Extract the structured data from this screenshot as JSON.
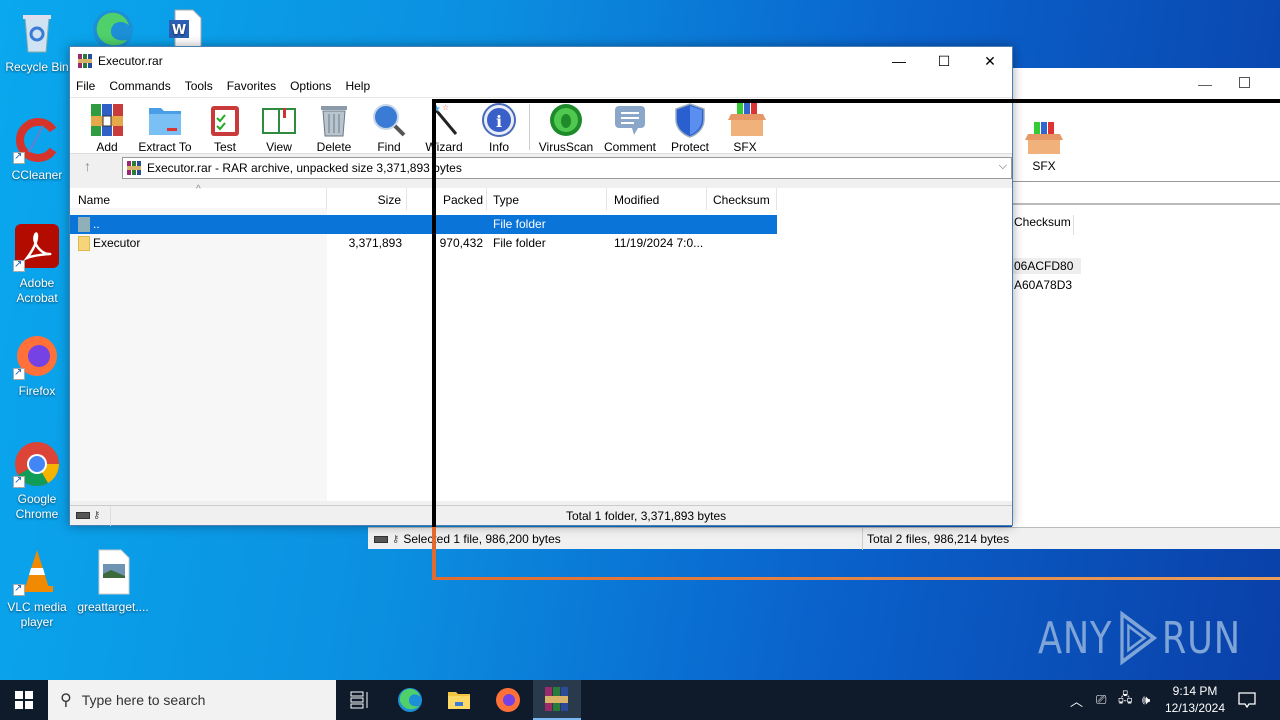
{
  "desktop": {
    "icons": [
      {
        "name": "recycle-bin",
        "label": "Recycle Bin"
      },
      {
        "name": "ccleaner",
        "label": "CCleaner"
      },
      {
        "name": "adobe-acrobat",
        "label": "Adobe Acrobat"
      },
      {
        "name": "firefox",
        "label": "Firefox"
      },
      {
        "name": "google-chrome",
        "label": "Google Chrome"
      },
      {
        "name": "vlc",
        "label": "VLC media player"
      },
      {
        "name": "greattarget",
        "label": "greattarget...."
      }
    ],
    "watermark": {
      "left": "ANY",
      "right": "RUN"
    }
  },
  "window": {
    "title": "Executor.rar",
    "controls": {
      "minimize": "—",
      "maximize": "☐",
      "close": "✕"
    },
    "menu": [
      "File",
      "Commands",
      "Tools",
      "Favorites",
      "Options",
      "Help"
    ],
    "toolbar": [
      {
        "id": "add",
        "label": "Add"
      },
      {
        "id": "extract-to",
        "label": "Extract To"
      },
      {
        "id": "test",
        "label": "Test"
      },
      {
        "id": "view",
        "label": "View"
      },
      {
        "id": "delete",
        "label": "Delete"
      },
      {
        "id": "find",
        "label": "Find"
      },
      {
        "id": "wizard",
        "label": "Wizard"
      },
      {
        "id": "info",
        "label": "Info"
      },
      {
        "id": "virusscan",
        "label": "VirusScan"
      },
      {
        "id": "comment",
        "label": "Comment"
      },
      {
        "id": "protect",
        "label": "Protect"
      },
      {
        "id": "sfx",
        "label": "SFX"
      }
    ],
    "address": "Executor.rar - RAR archive, unpacked size 3,371,893 bytes",
    "columns": [
      "Name",
      "Size",
      "Packed",
      "Type",
      "Modified",
      "Checksum"
    ],
    "rows": [
      {
        "name": "..",
        "size": "",
        "packed": "",
        "type": "File folder",
        "modified": "",
        "checksum": "",
        "selected": true
      },
      {
        "name": "Executor",
        "size": "3,371,893",
        "packed": "970,432",
        "type": "File folder",
        "modified": "11/19/2024 7:0...",
        "checksum": "",
        "selected": false
      }
    ],
    "status_total": "Total 1 folder, 3,371,893 bytes"
  },
  "background_window": {
    "toolbar_sfx": "SFX",
    "checksum_header": "Checksum",
    "checksums": [
      "06ACFD80",
      "A60A78D3"
    ],
    "status_selected": "Selected 1 file, 986,200 bytes",
    "status_total": "Total 2 files, 986,214 bytes"
  },
  "taskbar": {
    "search_placeholder": "Type here to search",
    "time": "9:14 PM",
    "date": "12/13/2024"
  }
}
